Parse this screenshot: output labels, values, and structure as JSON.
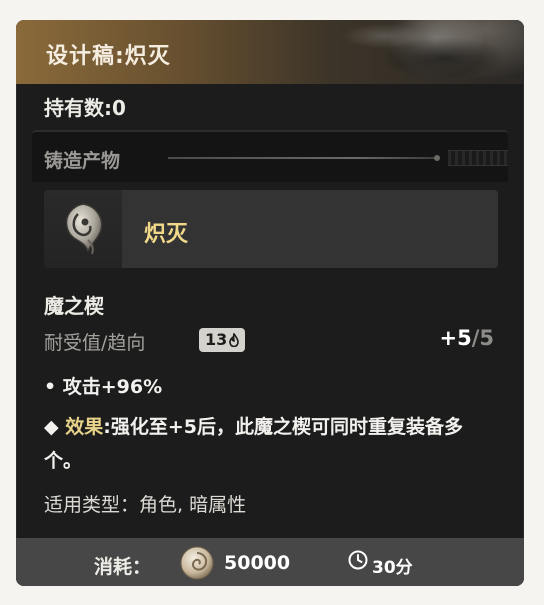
{
  "item": {
    "title": "设计稿:炽灭",
    "owned_count": "持有数:0"
  },
  "section": {
    "label": "铸造产物"
  },
  "product": {
    "name": "炽灭",
    "icon": "rune-icon"
  },
  "rune": {
    "name": "魔之楔",
    "endurance_label": "耐受值/趋向",
    "endurance_badge": "13",
    "endurance_current": "+5",
    "endurance_max": "/5"
  },
  "effects": {
    "bullet1": "• 攻击+96%",
    "bullet2_marker": "◆",
    "bullet2_highlight": "效果",
    "bullet2_text": ":强化至+5后，此魔之楔可同时重复装备多个。"
  },
  "types": "适用类型：角色, 暗属性",
  "footer": {
    "cost_label": "消耗：",
    "cost_value": "50000",
    "time_value": "30分"
  },
  "colors": {
    "highlight": "#e8d38a",
    "product_name": "#f2d98a",
    "panel": "#1c1c1c"
  }
}
